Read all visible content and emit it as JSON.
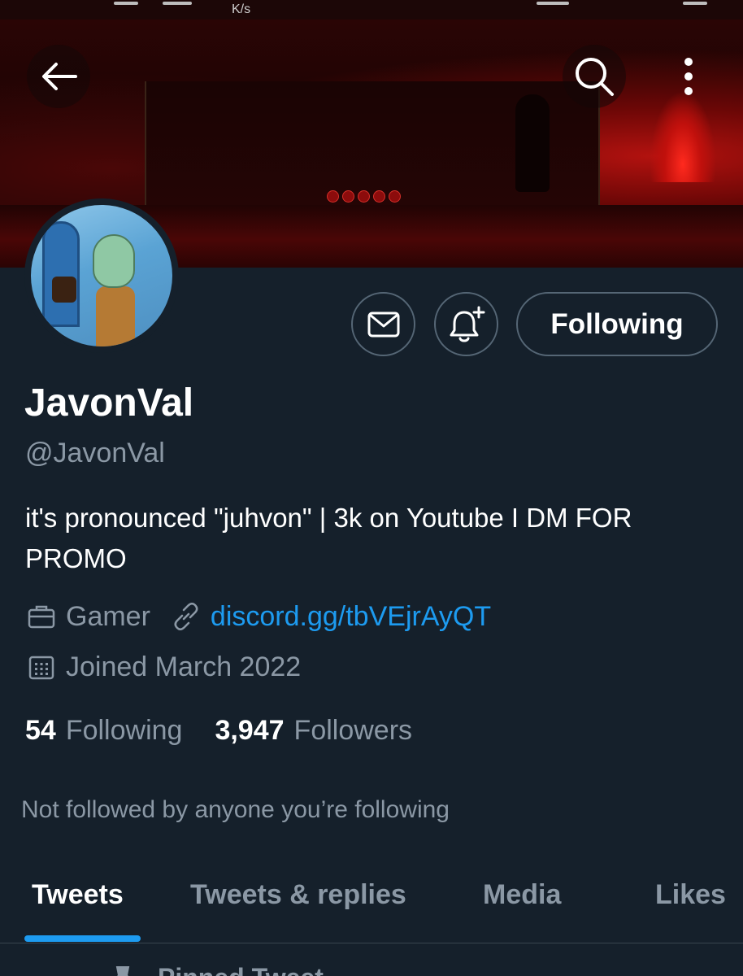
{
  "status_bar": {
    "net_speed_unit": "K/s"
  },
  "header": {
    "back_icon": "arrow-left-icon",
    "search_icon": "search-icon",
    "more_icon": "more-vertical-icon"
  },
  "profile": {
    "display_name": "JavonVal",
    "handle": "@JavonVal",
    "bio": "it's pronounced \"juhvon\" | 3k on Youtube I DM FOR PROMO",
    "category": "Gamer",
    "website": "discord.gg/tbVEjrAyQT",
    "joined": "Joined March 2022",
    "following_count": "54",
    "following_label": "Following",
    "followers_count": "3,947",
    "followers_label": "Followers",
    "mutuals_text": "Not followed by anyone you’re following"
  },
  "actions": {
    "message_icon": "mail-icon",
    "notify_icon": "bell-plus-icon",
    "follow_label": "Following"
  },
  "tabs": [
    {
      "label": "Tweets",
      "active": true
    },
    {
      "label": "Tweets & replies",
      "active": false
    },
    {
      "label": "Media",
      "active": false
    },
    {
      "label": "Likes",
      "active": false
    }
  ],
  "pinned": {
    "label": "Pinned Tweet"
  },
  "colors": {
    "background": "#15202b",
    "accent": "#1d9bf0",
    "muted": "#8b98a5",
    "border": "#556675"
  }
}
